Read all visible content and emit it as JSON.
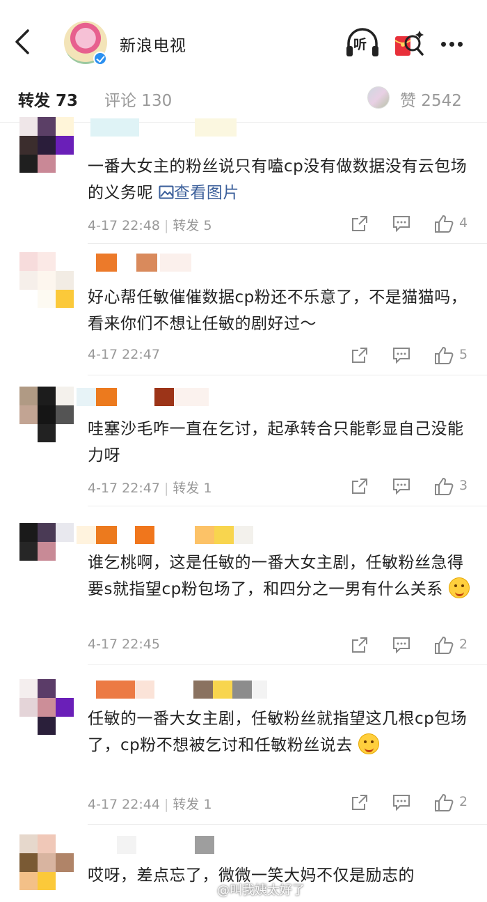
{
  "header": {
    "title": "新浪电视",
    "listen_label": "听"
  },
  "tabs": {
    "repost": "转发 73",
    "comment": "评论 130",
    "like": "赞 2542"
  },
  "comments": [
    {
      "text": "一番大女主的粉丝说只有嗑cp没有做数据没有云包场的义务呢",
      "link": "查看图片",
      "time": "4-17 22:48",
      "repost": "转发 5",
      "likes": "4"
    },
    {
      "text": "好心帮任敏催催数据cp粉还不乐意了，不是猫猫吗，看来你们不想让任敏的剧好过～",
      "time": "4-17 22:47",
      "repost": "",
      "likes": "5"
    },
    {
      "text": "哇塞沙毛咋一直在乞讨，起承转合只能彰显自己没能力呀",
      "time": "4-17 22:47",
      "repost": "转发 1",
      "likes": "3"
    },
    {
      "text": "谁乞桃啊，这是任敏的一番大女主剧，任敏粉丝急得要s就指望cp粉包场了，和四分之一男有什么关系",
      "time": "4-17 22:45",
      "repost": "",
      "likes": "2"
    },
    {
      "text": "任敏的一番大女主剧，任敏粉丝就指望这几根cp包场了，cp粉不想被乞讨和任敏粉丝说去",
      "time": "4-17 22:44",
      "repost": "转发 1",
      "likes": "2"
    },
    {
      "text": "哎呀，差点忘了，微微一笑大妈不仅是励志的",
      "time": "",
      "repost": "",
      "likes": ""
    }
  ],
  "watermark": "@叫我姨太好了",
  "icons": {
    "back": "back-arrow-icon",
    "listen": "headphones-icon",
    "redpack": "red-packet-icon",
    "more": "more-dots-icon",
    "share": "share-icon",
    "reply": "comment-bubble-icon",
    "like": "thumbs-up-icon",
    "image": "image-icon"
  },
  "colors": {
    "link": "#3a5e9a",
    "muted": "#999999",
    "text": "#222222",
    "verified": "#2b90f0",
    "redpack": "#e8303a"
  }
}
